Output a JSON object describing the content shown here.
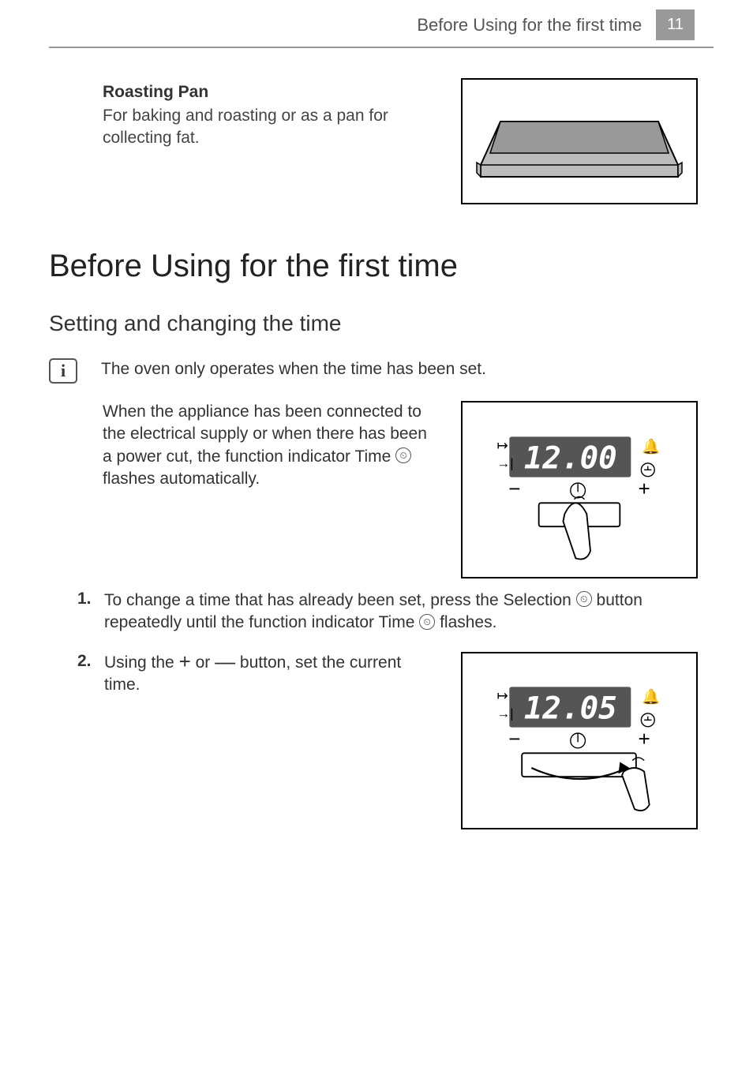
{
  "header": {
    "title": "Before Using for the first time",
    "page_number": "11"
  },
  "roasting": {
    "title": "Roasting Pan",
    "description": "For baking and roasting or as a pan for collecting fat."
  },
  "main_heading": "Before Using for the first time",
  "sub_heading": "Setting and changing the time",
  "info_note": "The oven only operates when the time has been set.",
  "intro_paragraph": {
    "pre": "When the appliance has been connected to the electrical supply or when there has been a power cut, the function indicator Time ",
    "post": " flashes automatically."
  },
  "steps": [
    {
      "num": "1.",
      "pre": "To change a time that has already been set, press the Selection ",
      "mid": " button repeatedly until the function indicator Time ",
      "post": " flashes."
    },
    {
      "num": "2.",
      "pre": "Using the ",
      "mid": " or ",
      "post": " button, set the current time."
    }
  ],
  "timer_displays": {
    "first": "12.00",
    "second": "12.05"
  }
}
